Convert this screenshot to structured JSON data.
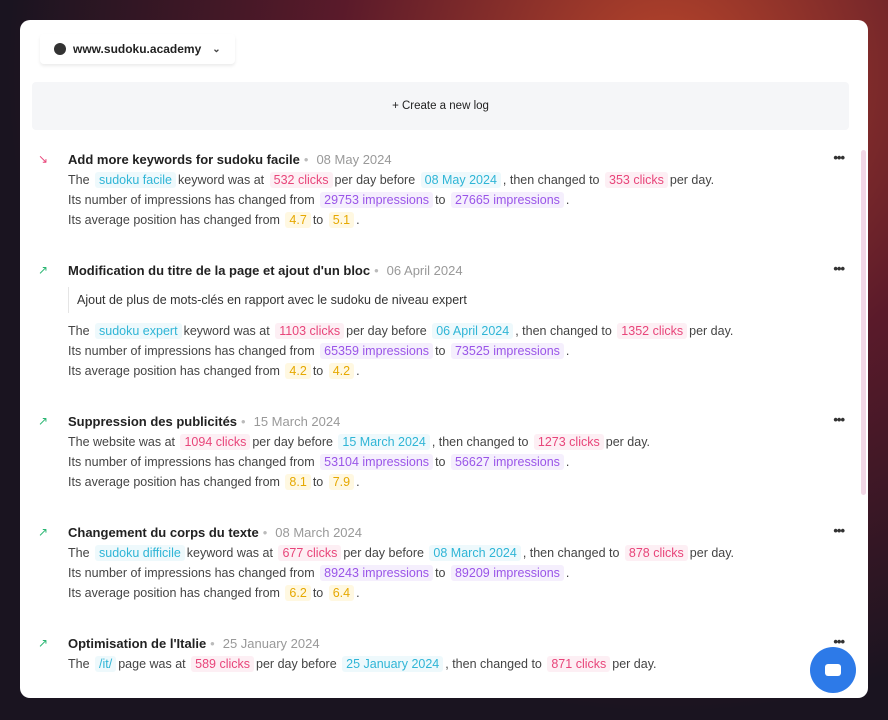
{
  "site": {
    "name": "www.sudoku.academy",
    "icon": "brain-icon"
  },
  "create_label": "+ Create a new log",
  "more_label": "•••",
  "colors": {
    "keyword": "#2fb5d6",
    "clicks": "#e8457a",
    "impressions": "#9a55e8",
    "position": "#e6a800",
    "chat": "#2d7ae8",
    "trend_up": "#2bb673",
    "trend_down": "#e8457a"
  },
  "logs": [
    {
      "title": "Add more keywords for sudoku facile",
      "date": "08 May 2024",
      "trend": "down",
      "lines": [
        [
          [
            "The",
            ""
          ],
          [
            "sudoku facile",
            "kw"
          ],
          [
            "keyword was at",
            ""
          ],
          [
            "532 clicks",
            "clicks"
          ],
          [
            "per day before",
            ""
          ],
          [
            "08 May 2024",
            "date2"
          ],
          [
            ", then changed to",
            ""
          ],
          [
            "353 clicks",
            "clicks"
          ],
          [
            "per day.",
            ""
          ]
        ],
        [
          [
            "Its number of impressions has changed from",
            ""
          ],
          [
            "29753 impressions",
            "imp"
          ],
          [
            "to",
            ""
          ],
          [
            "27665 impressions",
            "imp"
          ],
          [
            ".",
            ""
          ]
        ],
        [
          [
            "Its average position has changed from",
            ""
          ],
          [
            "4.7",
            "pos"
          ],
          [
            "to",
            ""
          ],
          [
            "5.1",
            "pos"
          ],
          [
            ".",
            ""
          ]
        ]
      ]
    },
    {
      "title": "Modification du titre de la page et ajout d'un bloc",
      "date": "06 April 2024",
      "trend": "up",
      "note": "Ajout de plus de mots-clés en rapport avec le sudoku de niveau expert",
      "lines": [
        [
          [
            "The",
            ""
          ],
          [
            "sudoku expert",
            "kw"
          ],
          [
            "keyword was at",
            ""
          ],
          [
            "1103 clicks",
            "clicks"
          ],
          [
            "per day before",
            ""
          ],
          [
            "06 April 2024",
            "date2"
          ],
          [
            ", then changed to",
            ""
          ],
          [
            "1352 clicks",
            "clicks"
          ],
          [
            "per day.",
            ""
          ]
        ],
        [
          [
            "Its number of impressions has changed from",
            ""
          ],
          [
            "65359 impressions",
            "imp"
          ],
          [
            "to",
            ""
          ],
          [
            "73525 impressions",
            "imp"
          ],
          [
            ".",
            ""
          ]
        ],
        [
          [
            "Its average position has changed from",
            ""
          ],
          [
            "4.2",
            "pos"
          ],
          [
            "to",
            ""
          ],
          [
            "4.2",
            "pos"
          ],
          [
            ".",
            ""
          ]
        ]
      ]
    },
    {
      "title": "Suppression des publicités",
      "date": "15 March 2024",
      "trend": "up",
      "lines": [
        [
          [
            "The website was at",
            ""
          ],
          [
            "1094 clicks",
            "clicks"
          ],
          [
            "per day before",
            ""
          ],
          [
            "15 March 2024",
            "date2"
          ],
          [
            ", then changed to",
            ""
          ],
          [
            "1273 clicks",
            "clicks"
          ],
          [
            "per day.",
            ""
          ]
        ],
        [
          [
            "Its number of impressions has changed from",
            ""
          ],
          [
            "53104 impressions",
            "imp"
          ],
          [
            "to",
            ""
          ],
          [
            "56627 impressions",
            "imp"
          ],
          [
            ".",
            ""
          ]
        ],
        [
          [
            "Its average position has changed from",
            ""
          ],
          [
            "8.1",
            "pos"
          ],
          [
            "to",
            ""
          ],
          [
            "7.9",
            "pos"
          ],
          [
            ".",
            ""
          ]
        ]
      ]
    },
    {
      "title": "Changement du corps du texte",
      "date": "08 March 2024",
      "trend": "up",
      "lines": [
        [
          [
            "The",
            ""
          ],
          [
            "sudoku difficile",
            "kw"
          ],
          [
            "keyword was at",
            ""
          ],
          [
            "677 clicks",
            "clicks"
          ],
          [
            "per day before",
            ""
          ],
          [
            "08 March 2024",
            "date2"
          ],
          [
            ", then changed to",
            ""
          ],
          [
            "878 clicks",
            "clicks"
          ],
          [
            "per day.",
            ""
          ]
        ],
        [
          [
            "Its number of impressions has changed from",
            ""
          ],
          [
            "89243 impressions",
            "imp"
          ],
          [
            "to",
            ""
          ],
          [
            "89209 impressions",
            "imp"
          ],
          [
            ".",
            ""
          ]
        ],
        [
          [
            "Its average position has changed from",
            ""
          ],
          [
            "6.2",
            "pos"
          ],
          [
            "to",
            ""
          ],
          [
            "6.4",
            "pos"
          ],
          [
            ".",
            ""
          ]
        ]
      ]
    },
    {
      "title": "Optimisation de l'Italie",
      "date": "25 January 2024",
      "trend": "up",
      "lines": [
        [
          [
            "The",
            ""
          ],
          [
            "/it/",
            "kw"
          ],
          [
            "page was at",
            ""
          ],
          [
            "589 clicks",
            "clicks"
          ],
          [
            "per day before",
            ""
          ],
          [
            "25 January 2024",
            "date2"
          ],
          [
            ", then changed to",
            ""
          ],
          [
            "871 clicks",
            "clicks"
          ],
          [
            "per day.",
            ""
          ]
        ]
      ]
    }
  ]
}
